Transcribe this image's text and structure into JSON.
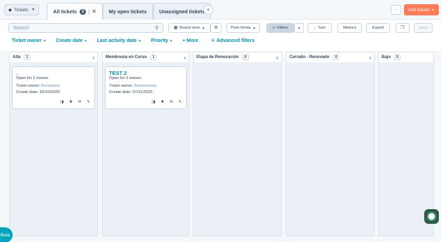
{
  "header": {
    "object_selector": "Tickets",
    "tabs": [
      {
        "label": "All tickets",
        "count": "2"
      },
      {
        "label": "My open tickets"
      },
      {
        "label": "Unassigned tickets"
      }
    ],
    "add_ticket_label": "Add tickets",
    "more_label": "···"
  },
  "toolbar": {
    "search_placeholder": "Search",
    "board_view": "Board view",
    "pipeline": "Post-Venta",
    "filters": "Filters",
    "sort": "Sort",
    "metrics": "Metrics",
    "export": "Export",
    "save": "Save"
  },
  "quick_filters": {
    "ticket_owner": "Ticket owner",
    "create_date": "Create date",
    "last_activity": "Last activity date",
    "priority": "Priority",
    "more": "+ More",
    "advanced": "Advanced filters"
  },
  "columns": [
    {
      "name": "Alta",
      "count": "1",
      "card": {
        "title": ".",
        "open_for": "Open for 2 meses",
        "owner_label": "Ticket owner:",
        "owner_value": "Bxxxxxxxxx",
        "create_label": "Create date:",
        "create_value": "30/10/2025"
      }
    },
    {
      "name": "Membresia en Curso",
      "count": "1",
      "card": {
        "title": "TEST 2",
        "open_for": "Open for 2 meses",
        "owner_label": "Ticket owner:",
        "owner_value": "Bxxxxxxxxxxx",
        "create_label": "Create date:",
        "create_value": "07/11/2025"
      }
    },
    {
      "name": "Etapa de Renovación",
      "count": "0"
    },
    {
      "name": "Cerrado - Renovado",
      "count": "0"
    },
    {
      "name": "Bajo",
      "count": "0"
    }
  ],
  "beta_label": "Beta",
  "colors": {
    "accent": "#0091ae",
    "primary_button": "#ff7a59",
    "column_bg": "#eaf0f6",
    "beta": "#00a4bd"
  }
}
